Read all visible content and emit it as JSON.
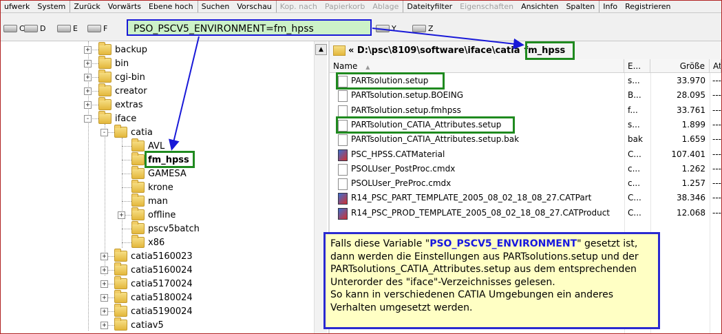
{
  "menu": [
    "ufwerk",
    "System",
    "Zurück",
    "Vorwärts",
    "Ebene hoch",
    "Suchen",
    "Vorschau",
    "Kop. nach",
    "Papierkorb",
    "Ablage",
    "Dateityfilter",
    "Eigenschaften",
    "Ansichten",
    "Spalten",
    "Info",
    "Registrieren"
  ],
  "menu_disabled": [
    false,
    false,
    false,
    false,
    false,
    false,
    false,
    true,
    true,
    true,
    false,
    true,
    false,
    false,
    false,
    false
  ],
  "drives": [
    "C",
    "D",
    "E",
    "F",
    "Y",
    "Z"
  ],
  "env_box": "PSO_PSCV5_ENVIRONMENT=fm_hpss",
  "tree": [
    {
      "label": "backup"
    },
    {
      "label": "bin"
    },
    {
      "label": "cgi-bin"
    },
    {
      "label": "creator"
    },
    {
      "label": "extras"
    },
    {
      "label": "iface"
    },
    {
      "label": "catia"
    },
    {
      "label": "AVL"
    },
    {
      "label": "fm_hpss"
    },
    {
      "label": "GAMESA"
    },
    {
      "label": "krone"
    },
    {
      "label": "man"
    },
    {
      "label": "offline"
    },
    {
      "label": "pscv5batch"
    },
    {
      "label": "x86"
    },
    {
      "label": "catia5160023"
    },
    {
      "label": "catia5160024"
    },
    {
      "label": "catia5170024"
    },
    {
      "label": "catia5180024"
    },
    {
      "label": "catia5190024"
    },
    {
      "label": "catiav5"
    }
  ],
  "path": {
    "prefix": "« D:\\psc\\8109\\software\\iface\\catia",
    "current": "fm_hpss"
  },
  "columns": {
    "name": "Name",
    "ext": "E...",
    "size": "Größe",
    "attr": "Att"
  },
  "files": [
    {
      "name": "PARTsolution.setup",
      "ext": "s...",
      "size": "33.970",
      "attr": "---"
    },
    {
      "name": "PARTsolution.setup.BOEING",
      "ext": "B...",
      "size": "28.095",
      "attr": "---"
    },
    {
      "name": "PARTsolution.setup.fmhpss",
      "ext": "f...",
      "size": "33.761",
      "attr": "---"
    },
    {
      "name": "PARTsolution_CATIA_Attributes.setup",
      "ext": "s...",
      "size": "1.899",
      "attr": "---"
    },
    {
      "name": "PARTsolution_CATIA_Attributes.setup.bak",
      "ext": "bak",
      "size": "1.659",
      "attr": "---"
    },
    {
      "name": "PSC_HPSS.CATMaterial",
      "ext": "C...",
      "size": "107.401",
      "attr": "---"
    },
    {
      "name": "PSOLUser_PostProc.cmdx",
      "ext": "c...",
      "size": "1.262",
      "attr": "---"
    },
    {
      "name": "PSOLUser_PreProc.cmdx",
      "ext": "c...",
      "size": "1.257",
      "attr": "---"
    },
    {
      "name": "R14_PSC_PART_TEMPLATE_2005_08_02_18_08_27.CATPart",
      "ext": "C...",
      "size": "38.346",
      "attr": "---"
    },
    {
      "name": "R14_PSC_PROD_TEMPLATE_2005_08_02_18_08_27.CATProduct",
      "ext": "C...",
      "size": "12.068",
      "attr": "---"
    }
  ],
  "note": {
    "l1_pre": "Falls diese Variable \"",
    "l1_var": "PSO_PSCV5_ENVIRONMENT",
    "l1_post": "\" gesetzt ist,",
    "l2": "dann werden die Einstellungen aus PARTsolutions.setup und der",
    "l3": "PARTsolutions_CATIA_Attributes.setup aus dem entsprechenden",
    "l4": "Unterorder des \"iface\"-Verzeichnisses gelesen.",
    "l5": "So kann in verschiedenen CATIA Umgebungen ein anderes",
    "l6": "Verhalten umgesetzt werden."
  },
  "colors": {
    "annotation_blue": "#1818d8",
    "highlight_green": "#1f8a1f",
    "env_box_fill": "#ccf2c8",
    "note_fill": "#ffffc4"
  }
}
